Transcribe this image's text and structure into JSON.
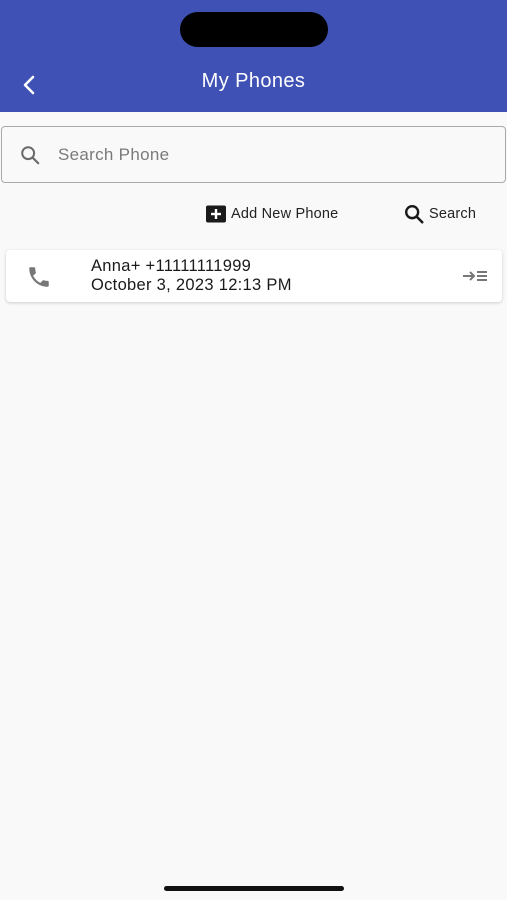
{
  "header": {
    "title": "My Phones",
    "background": "#3f51b5"
  },
  "search": {
    "placeholder": "Search Phone",
    "value": ""
  },
  "actions": {
    "add_label": "Add New Phone",
    "search_label": "Search"
  },
  "phones": [
    {
      "name_number": "Anna+ +11111111999",
      "timestamp": "October 3, 2023 12:13 PM"
    }
  ],
  "icons": {
    "back": "chevron-left-icon",
    "search": "search-icon",
    "add": "add-box-icon",
    "phone": "phone-icon",
    "open": "open-details-icon"
  }
}
